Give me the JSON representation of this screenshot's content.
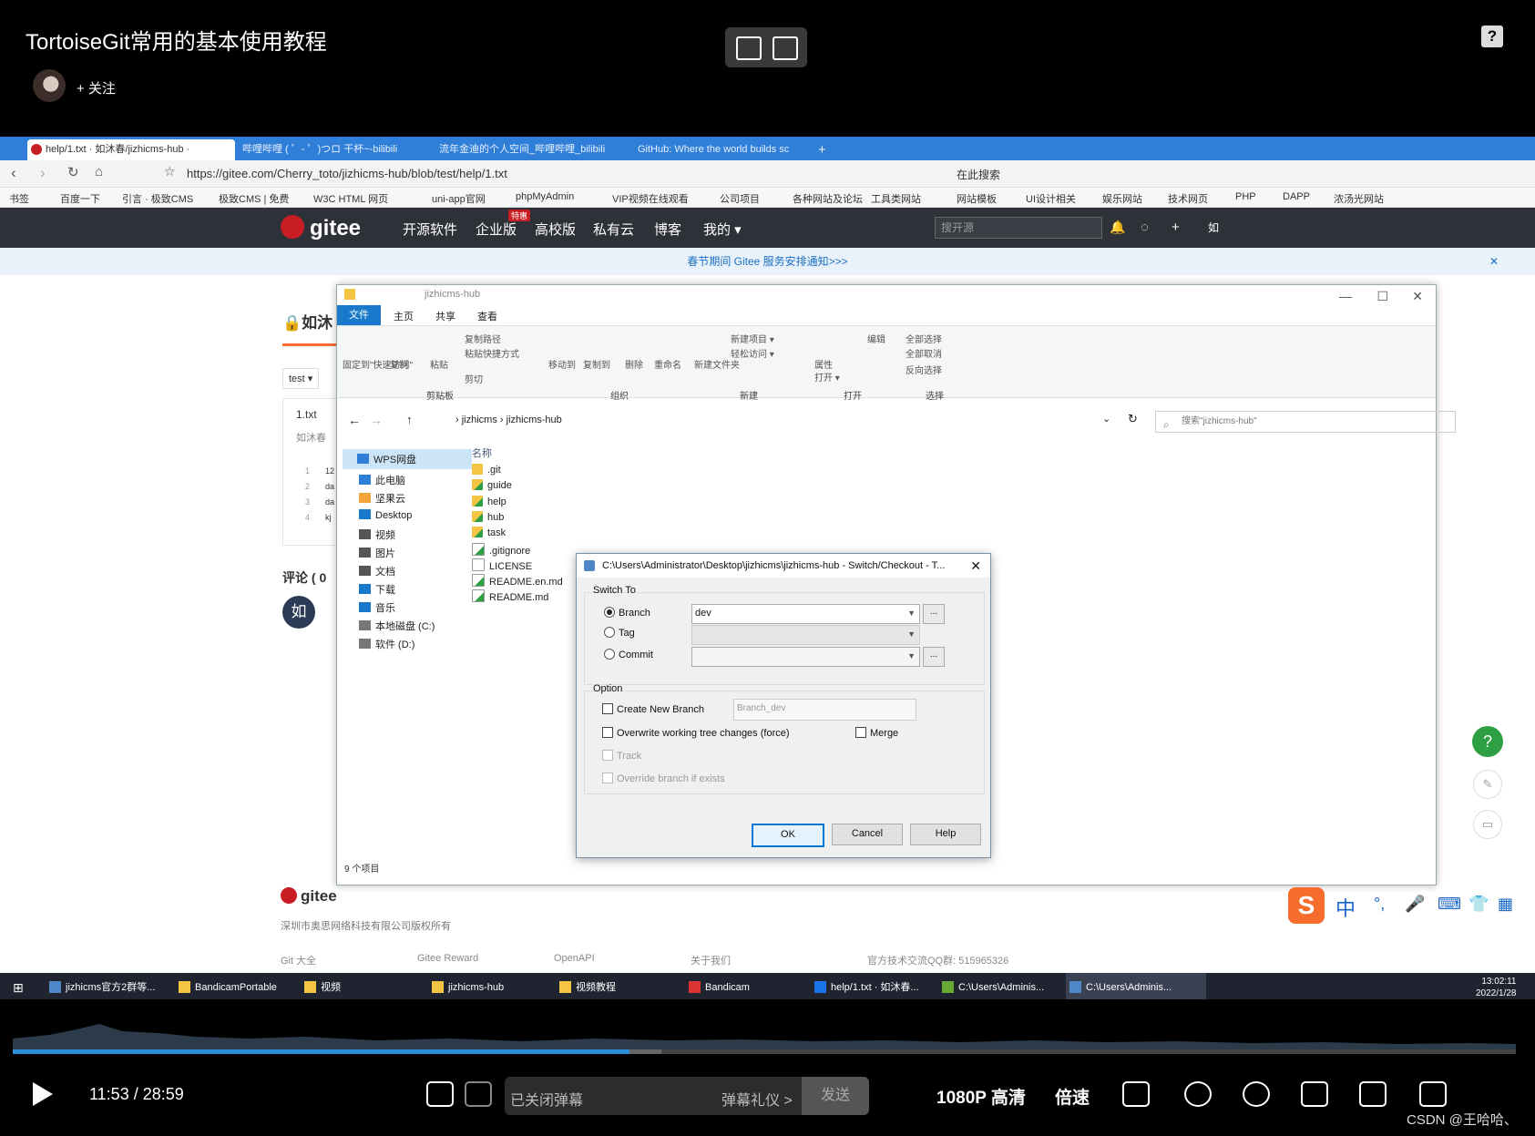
{
  "player": {
    "video_title": "TortoiseGit常用的基本使用教程",
    "follow_label": "+ 关注",
    "current_time": "11:53",
    "separator": "/",
    "duration": "28:59",
    "progress_fraction": 0.41,
    "danmaku_placeholder": "已关闭弹幕",
    "danmaku_etiquette": "弹幕礼仪 >",
    "send_label": "发送",
    "quality_label": "1080P 高清",
    "speed_label": "倍速",
    "watermark": "CSDN @王哈哈、"
  },
  "browser": {
    "tabs": [
      {
        "label": "help/1.txt · 如沐春/jizhicms-hub ·",
        "active": true
      },
      {
        "label": "哔哩哔哩 ( ゜- ゜)つロ 干杯~-bilibili",
        "active": false
      },
      {
        "label": "流年金迪的个人空间_哔哩哔哩_bilibili",
        "active": false
      },
      {
        "label": "GitHub: Where the world builds sc",
        "active": false
      }
    ],
    "url": "https://gitee.com/Cherry_toto/jizhicms-hub/blob/test/help/1.txt",
    "search_placeholder": "在此搜索",
    "bookmarks": [
      "书签",
      "百度一下",
      "引言 · 极致CMS",
      "极致CMS | 免费",
      "W3C HTML 网页",
      "uni-app官网",
      "phpMyAdmin",
      "VIP视频在线观看",
      "公司项目",
      "各种网站及论坛",
      "工具类网站",
      "网站模板",
      "UI设计相关",
      "娱乐网站",
      "技术网页",
      "PHP",
      "DAPP",
      "浓汤光网站"
    ]
  },
  "gitee": {
    "logo": "gitee",
    "nav": [
      "开源软件",
      "企业版",
      "高校版",
      "私有云",
      "博客",
      "我的 ▾"
    ],
    "badge": "特惠",
    "search_placeholder": "搜开源",
    "user_initial": "如",
    "notice": "春节期间 Gitee 服务安排通知>>>",
    "repo_stub": "如沐",
    "branch_stub": "test ▾",
    "file_stub": "1.txt",
    "author_stub": "如沐春",
    "line_numbers": [
      "1",
      "2",
      "3",
      "4"
    ],
    "line_stubs": [
      "12",
      "da",
      "da",
      "kj"
    ],
    "comments_stub": "评论 ( 0",
    "avatar_initial": "如",
    "footer_logo": "gitee",
    "footer_company": "深圳市奥思网络科技有限公司版权所有",
    "footer_links": [
      "Git 大全",
      "Gitee Reward",
      "OpenAPI",
      "关于我们"
    ],
    "footer_qq": "官方技术交流QQ群: 515965326"
  },
  "explorer": {
    "title": "jizhicms-hub",
    "ribbon_tabs": [
      "文件",
      "主页",
      "共享",
      "查看"
    ],
    "ribbon_items": [
      "固定到\"快速访问\"",
      "复制",
      "粘贴",
      "复制路径",
      "粘贴快捷方式",
      "剪切",
      "移动到",
      "复制到",
      "删除",
      "重命名",
      "新建文件夹",
      "新建项目 ▾",
      "轻松访问 ▾",
      "属性",
      "打开 ▾",
      "编辑",
      "全部选择",
      "全部取消",
      "反向选择"
    ],
    "ribbon_groups": [
      "剪贴板",
      "组织",
      "新建",
      "打开",
      "选择"
    ],
    "breadcrumb": [
      "jizhicms",
      "jizhicms-hub"
    ],
    "search_placeholder": "搜索\"jizhicms-hub\"",
    "sidebar": [
      "WPS网盘",
      "此电脑",
      "坚果云",
      "Desktop",
      "视频",
      "图片",
      "文档",
      "下载",
      "音乐",
      "本地磁盘 (C:)",
      "软件 (D:)"
    ],
    "column_header": "名称",
    "files": [
      ".git",
      "guide",
      "help",
      "hub",
      "task",
      ".gitignore",
      "LICENSE",
      "README.en.md",
      "README.md"
    ],
    "status": "9 个项目"
  },
  "dialog": {
    "title": "C:\\Users\\Administrator\\Desktop\\jizhicms\\jizhicms-hub - Switch/Checkout - T...",
    "switch_to_label": "Switch To",
    "branch_label": "Branch",
    "branch_value": "dev",
    "tag_label": "Tag",
    "commit_label": "Commit",
    "browse_label": "...",
    "option_label": "Option",
    "create_new_branch_label": "Create New Branch",
    "new_branch_name": "Branch_dev",
    "overwrite_label": "Overwrite working tree changes (force)",
    "merge_label": "Merge",
    "track_label": "Track",
    "override_label": "Override branch if exists",
    "ok_label": "OK",
    "cancel_label": "Cancel",
    "help_label": "Help"
  },
  "taskbar": {
    "items": [
      "jizhicms官方2群等...",
      "BandicamPortable",
      "视频",
      "jizhicms-hub",
      "视频教程",
      "Bandicam",
      "help/1.txt · 如沐春...",
      "C:\\Users\\Adminis...",
      "C:\\Users\\Adminis..."
    ],
    "time": "13:02:11",
    "date": "2022/1/28"
  },
  "ime": {
    "logo": "S",
    "mode": "中"
  }
}
